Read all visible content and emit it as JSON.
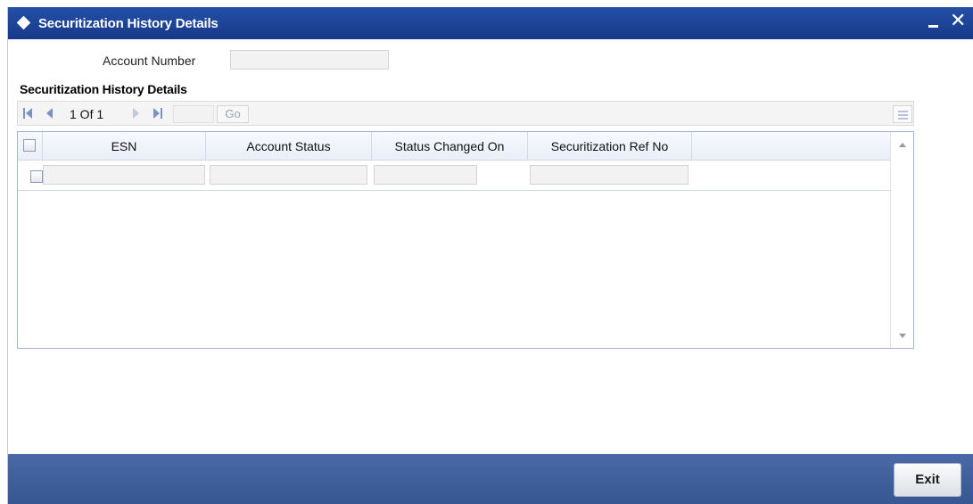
{
  "window": {
    "title": "Securitization History Details"
  },
  "form": {
    "account_number_label": "Account Number",
    "account_number_value": ""
  },
  "section": {
    "title": "Securitization History Details"
  },
  "pager": {
    "page_text": "1 Of 1",
    "page_input_value": "",
    "go_label": "Go"
  },
  "grid": {
    "columns": [
      "ESN",
      "Account Status",
      "Status Changed On",
      "Securitization Ref No"
    ],
    "rows": [
      {
        "esn": "",
        "account_status": "",
        "status_changed_on": "",
        "securitization_ref_no": ""
      }
    ]
  },
  "footer": {
    "exit_label": "Exit"
  },
  "colors": {
    "titlebar": "#1b3f8a",
    "footer": "#3f5f9e",
    "grid_border": "#9fb4d8"
  },
  "icons": [
    "diamond-icon",
    "minimize-icon",
    "close-icon",
    "first-page-icon",
    "prev-page-icon",
    "next-page-icon",
    "last-page-icon",
    "grid-settings-icon",
    "scroll-up-icon",
    "scroll-down-icon"
  ]
}
